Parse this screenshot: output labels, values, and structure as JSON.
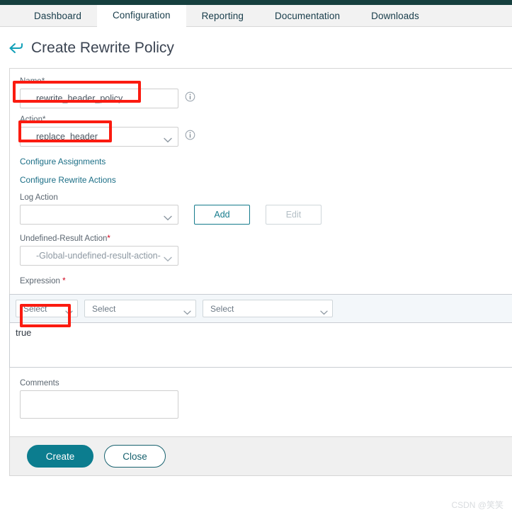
{
  "nav": {
    "tabs": [
      {
        "label": "Dashboard",
        "active": false
      },
      {
        "label": "Configuration",
        "active": true
      },
      {
        "label": "Reporting",
        "active": false
      },
      {
        "label": "Documentation",
        "active": false
      },
      {
        "label": "Downloads",
        "active": false
      }
    ]
  },
  "header": {
    "back_icon": "back-arrow-icon",
    "title": "Create Rewrite Policy"
  },
  "form": {
    "name": {
      "label": "Name",
      "required_mark": "*",
      "value": "rewrite_header_policy",
      "placeholder": "",
      "info_icon": "info-icon"
    },
    "action": {
      "label": "Action",
      "required_mark": "*",
      "value": "replace_header",
      "info_icon": "info-icon"
    },
    "links": [
      {
        "label": "Configure Assignments"
      },
      {
        "label": "Configure Rewrite Actions"
      }
    ],
    "log_action": {
      "label": "Log Action",
      "value": "",
      "add_button": "Add",
      "edit_button": "Edit",
      "edit_disabled": true
    },
    "undefined_result_action": {
      "label": "Undefined-Result Action",
      "required_mark": "*",
      "value": "-Global-undefined-result-action-"
    },
    "expression": {
      "label": "Expression",
      "required_mark": "*",
      "selectors": [
        {
          "value": "Select"
        },
        {
          "value": "Select"
        },
        {
          "value": "Select"
        }
      ],
      "text": "true",
      "placeholder": ""
    },
    "comments": {
      "label": "Comments",
      "value": "",
      "placeholder": ""
    }
  },
  "footer": {
    "create_label": "Create",
    "close_label": "Close"
  },
  "watermark": {
    "text": "CSDN @笑笑"
  },
  "colors": {
    "brand_teal": "#0c7d8f",
    "top_strip": "#16403f",
    "link": "#1b6e86",
    "annotation_red": "#fb1b10",
    "required_red": "#d0021b"
  }
}
